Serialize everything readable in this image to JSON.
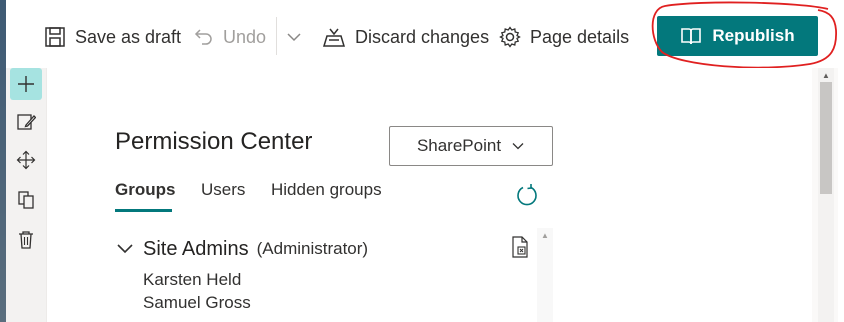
{
  "toolbar": {
    "save_draft": "Save as draft",
    "undo": "Undo",
    "discard": "Discard changes",
    "page_details": "Page details",
    "republish": "Republish"
  },
  "webpart": {
    "title": "Permission Center",
    "dropdown_value": "SharePoint",
    "tabs": [
      "Groups",
      "Users",
      "Hidden groups"
    ],
    "active_tab": "Groups",
    "groups": [
      {
        "name": "Site Admins",
        "role": "(Administrator)",
        "members": [
          "Karsten Held",
          "Samuel Gross"
        ]
      }
    ]
  },
  "colors": {
    "accent": "#03787c",
    "annotation": "#e02020"
  },
  "icons": [
    "save-icon",
    "undo-icon",
    "chevron-down-icon",
    "discard-icon",
    "gear-icon",
    "book-icon",
    "add-icon",
    "edit-icon",
    "move-icon",
    "duplicate-icon",
    "trash-icon",
    "refresh-icon",
    "export-icon"
  ]
}
